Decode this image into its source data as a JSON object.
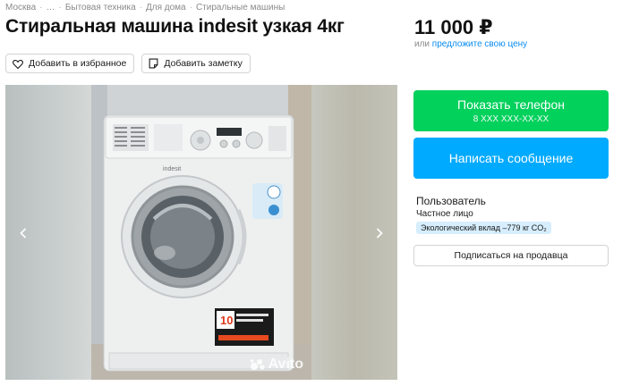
{
  "breadcrumb": [
    "Москва",
    "…",
    "Бытовая техника",
    "Для дома",
    "Стиральные машины"
  ],
  "listing": {
    "title": "Стиральная машина indesit узкая 4кг",
    "price": "11 000 ₽",
    "offer_prefix": "или",
    "offer_link": "предложите свою цену"
  },
  "actions": {
    "favorite_label": "Добавить в избранное",
    "note_label": "Добавить заметку"
  },
  "gallery": {
    "watermark": "Avito",
    "prev_icon": "chevron-left-icon",
    "next_icon": "chevron-right-icon"
  },
  "contact": {
    "phone_label": "Показать телефон",
    "phone_number": "8 XXX XXX-XX-XX",
    "message_label": "Написать сообщение"
  },
  "seller": {
    "name": "Пользователь",
    "type": "Частное лицо",
    "eco_badge": "Экологический вклад –779 кг CO₂",
    "subscribe_label": "Подписаться на продавца"
  },
  "colors": {
    "phone_button": "#02d15c",
    "message_button": "#00aaff",
    "link": "#0a8cf0",
    "eco_badge_bg": "#d6eefd"
  }
}
